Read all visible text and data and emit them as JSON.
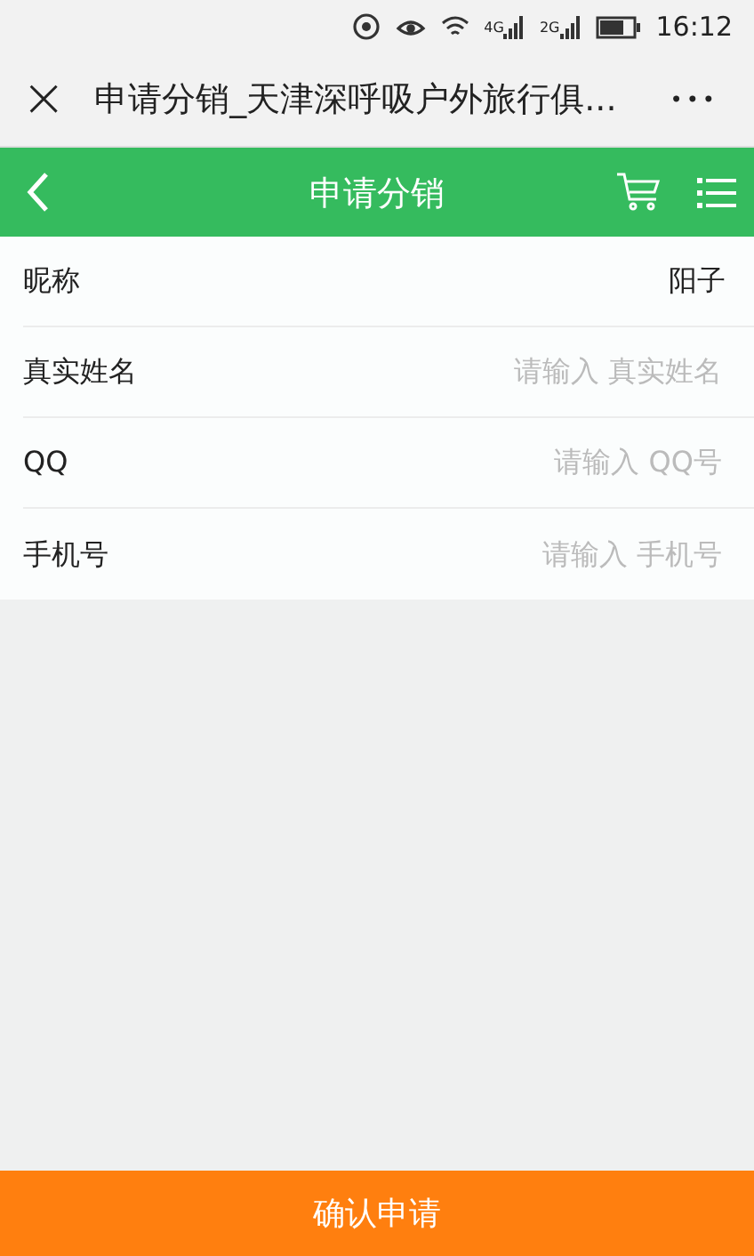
{
  "status_bar": {
    "network_4g": "4G",
    "network_2g": "2G",
    "time": "16:12"
  },
  "browser_bar": {
    "close": "×",
    "title": "申请分销_天津深呼吸户外旅行俱...",
    "more": "•••"
  },
  "header": {
    "title": "申请分销"
  },
  "form": [
    {
      "kind": "value",
      "label": "昵称",
      "value": "阳子"
    },
    {
      "kind": "input",
      "label": "真实姓名",
      "placeholder": "请输入 真实姓名"
    },
    {
      "kind": "input",
      "label": "QQ",
      "placeholder": "请输入 QQ号"
    },
    {
      "kind": "input",
      "label": "手机号",
      "placeholder": "请输入 手机号"
    }
  ],
  "submit": {
    "label": "确认申请"
  }
}
